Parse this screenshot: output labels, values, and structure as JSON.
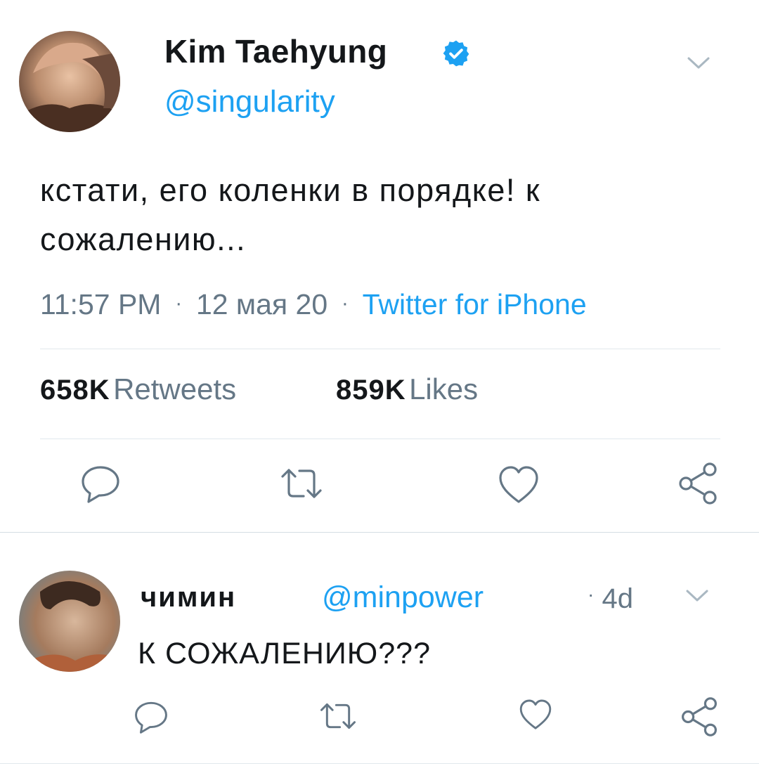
{
  "tweet": {
    "author_name": "Kim Taehyung",
    "verified": true,
    "handle": "@singularity",
    "text_line1": "кстати, его коленки в порядке! к",
    "text_line2": "сожалению...",
    "time": "11:57 PM",
    "date": "12 мая 20",
    "source": "Twitter for iPhone",
    "retweets_count": "658K",
    "retweets_label": "Retweets",
    "likes_count": "859K",
    "likes_label": "Likes"
  },
  "reply": {
    "author_name": "чимин",
    "handle": "@minpower",
    "age": "4d",
    "text": "К СОЖАЛЕНИЮ???"
  },
  "icons": {
    "reply": "reply-icon",
    "retweet": "retweet-icon",
    "like": "heart-icon",
    "share": "share-icon",
    "verified": "verified-badge-icon",
    "menu": "chevron-down-icon"
  },
  "colors": {
    "accent": "#1da1f2",
    "secondary_text": "#657786",
    "icon_gray": "#657786",
    "divider": "#e1e8ed"
  }
}
